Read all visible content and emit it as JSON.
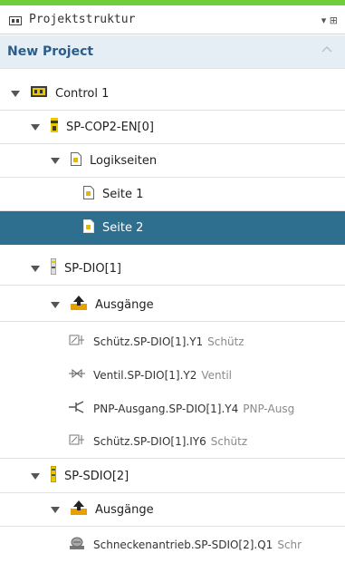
{
  "panel": {
    "title": "Projektstruktur",
    "pin_glyph": "▾ ⊞"
  },
  "project": {
    "title": "New Project"
  },
  "tree": [
    {
      "label": "Control 1",
      "icon": "controller-icon",
      "expanded": true
    },
    {
      "label": "SP-COP2-EN[0]",
      "icon": "module-icon",
      "expanded": true
    },
    {
      "label": "Logikseiten",
      "icon": "logic-page-folder-icon",
      "expanded": true
    },
    {
      "label": "Seite 1",
      "icon": "page-icon"
    },
    {
      "label": "Seite 2",
      "icon": "page-icon",
      "selected": true
    },
    {
      "label": "SP-DIO[1]",
      "icon": "io-module-icon",
      "expanded": true
    },
    {
      "label": "Ausgänge",
      "icon": "outputs-icon",
      "expanded": true
    },
    {
      "label": "Schütz.SP-DIO[1].Y1",
      "sublabel": "Schütz",
      "icon": "contactor-icon"
    },
    {
      "label": "Ventil.SP-DIO[1].Y2",
      "sublabel": "Ventil",
      "icon": "valve-icon"
    },
    {
      "label": "PNP-Ausgang.SP-DIO[1].Y4",
      "sublabel": "PNP-Ausg",
      "icon": "pnp-output-icon"
    },
    {
      "label": "Schütz.SP-DIO[1].IY6",
      "sublabel": "Schütz",
      "icon": "contactor-icon"
    },
    {
      "label": "SP-SDIO[2]",
      "icon": "io-module-icon",
      "expanded": true
    },
    {
      "label": "Ausgänge",
      "icon": "outputs-icon",
      "expanded": true
    },
    {
      "label": "Schneckenantrieb.SP-SDIO[2].Q1",
      "sublabel": "Schr",
      "icon": "motor-icon"
    }
  ],
  "colors": {
    "accent": "#6fcf3a",
    "selected": "#2e6e8e",
    "project_bg": "#e6eef5"
  }
}
